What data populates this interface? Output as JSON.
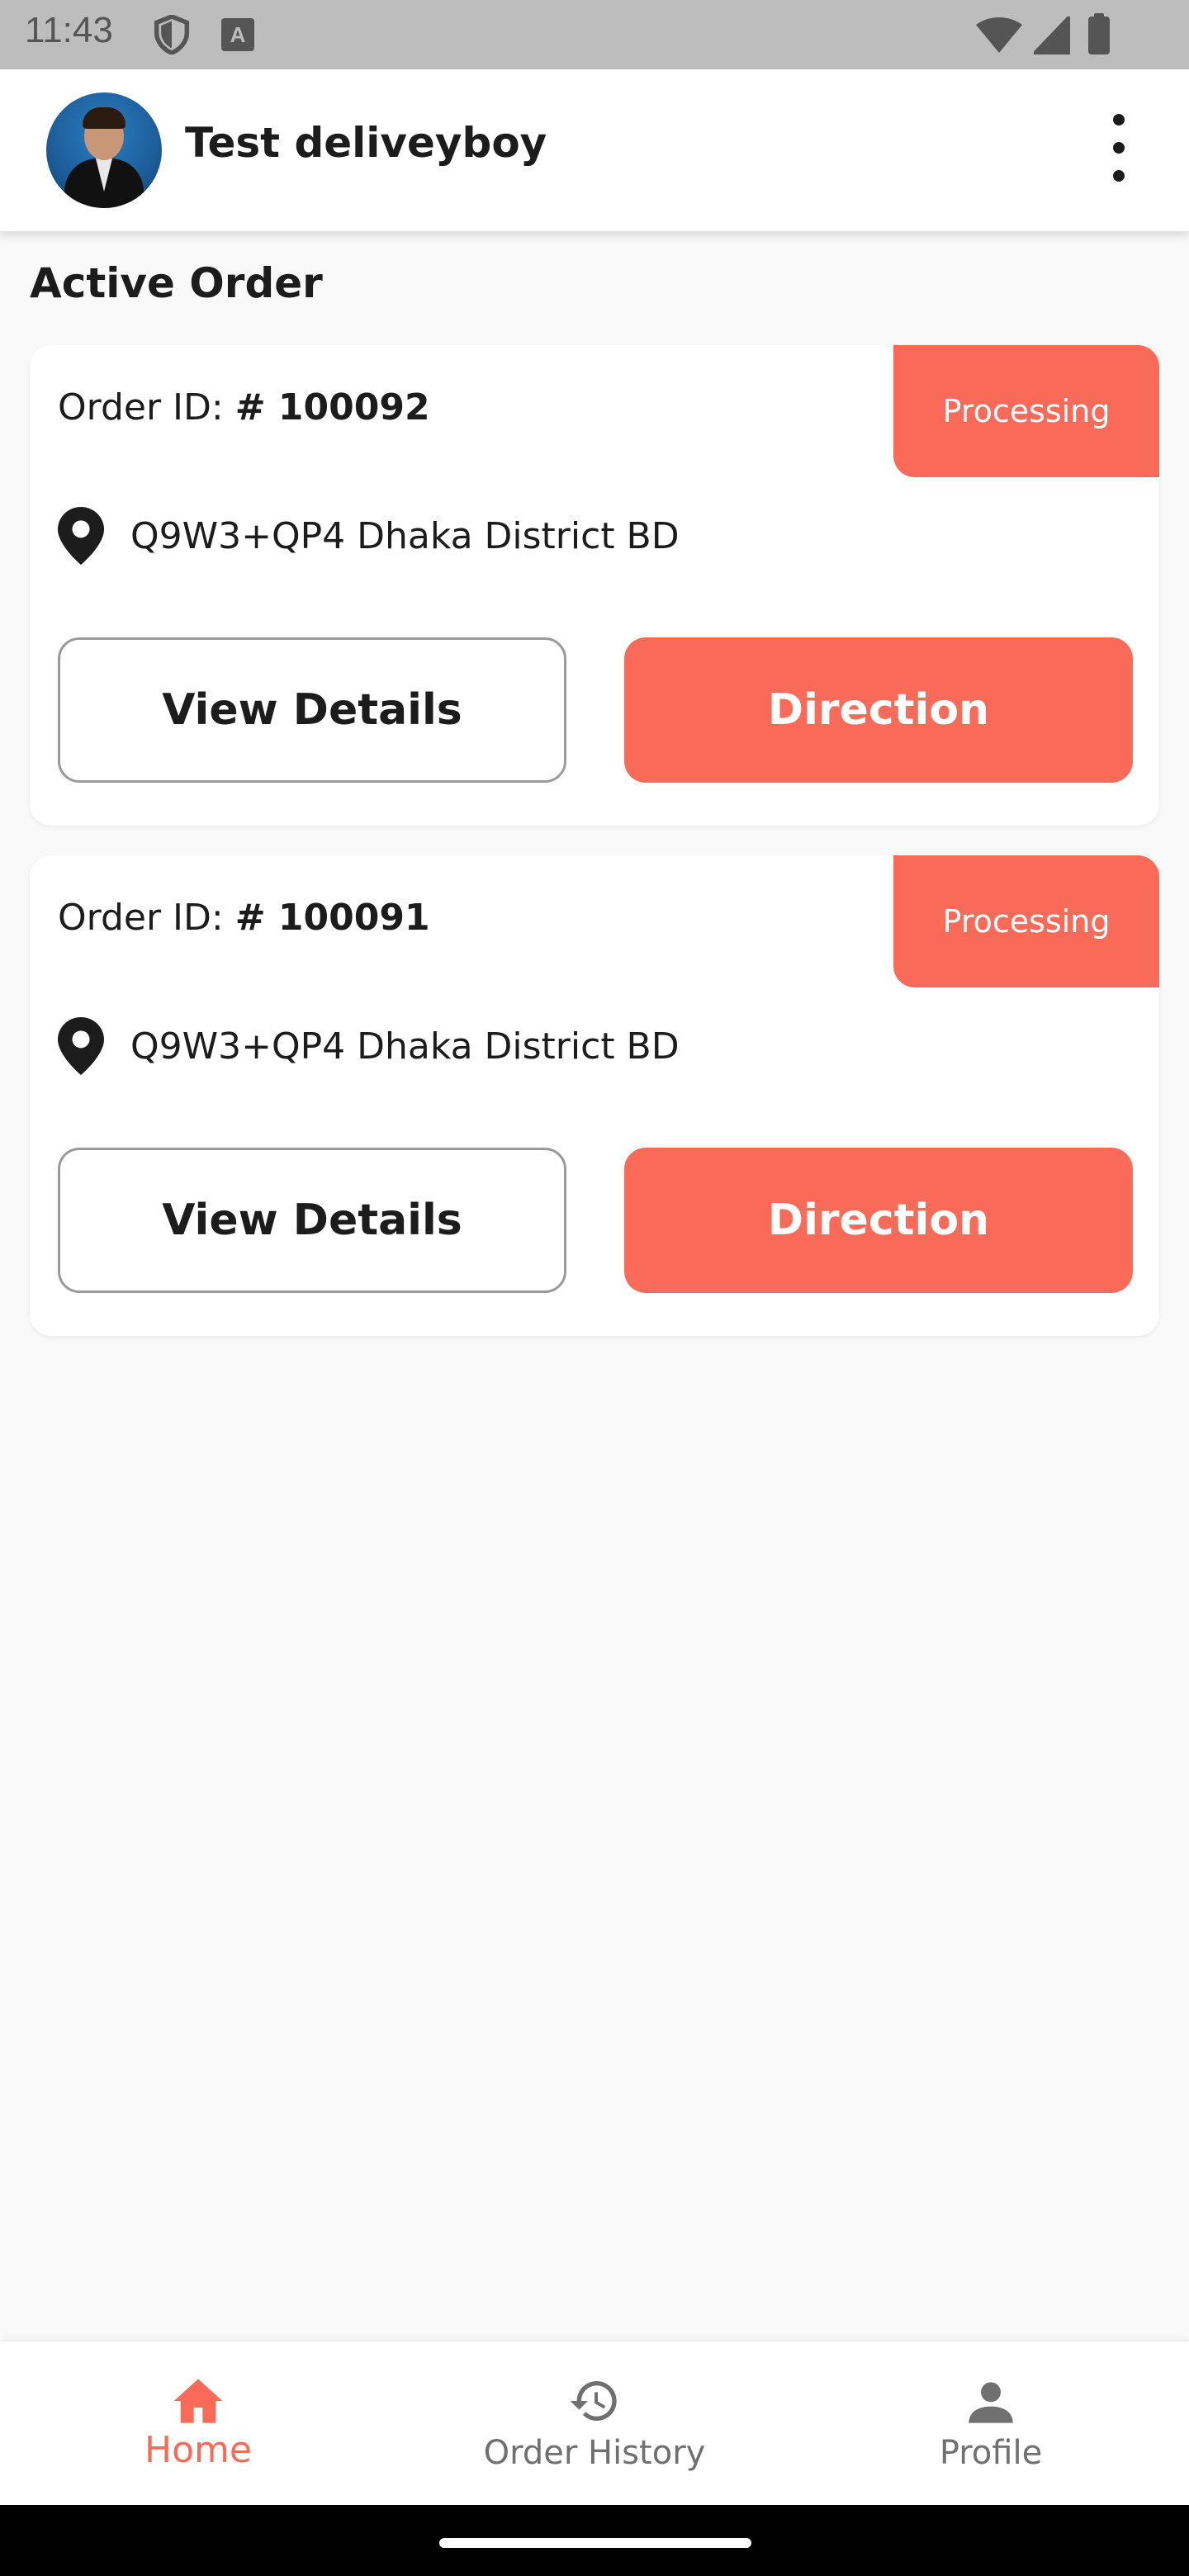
{
  "status_bar": {
    "time": "11:43",
    "icons": [
      "shield-icon",
      "text-a-icon",
      "wifi-icon",
      "signal-icon",
      "battery-icon"
    ],
    "a_glyph": "A"
  },
  "app_bar": {
    "user_name": "Test deliveyboy",
    "menu_icon": "more-vertical-icon"
  },
  "section": {
    "title": "Active Order"
  },
  "orders": [
    {
      "id_label": "Order ID:",
      "id_value": "# 100092",
      "status": "Processing",
      "address": "Q9W3+QP4 Dhaka District BD",
      "details_label": "View Details",
      "direction_label": "Direction"
    },
    {
      "id_label": "Order ID:",
      "id_value": "# 100091",
      "status": "Processing",
      "address": "Q9W3+QP4 Dhaka District BD",
      "details_label": "View Details",
      "direction_label": "Direction"
    }
  ],
  "bottom_nav": {
    "items": [
      {
        "label": "Home",
        "icon": "home-icon",
        "active": true
      },
      {
        "label": "Order History",
        "icon": "history-icon",
        "active": false
      },
      {
        "label": "Profile",
        "icon": "person-icon",
        "active": false
      }
    ]
  },
  "colors": {
    "accent": "#fa6a58",
    "text": "#1c1c1c",
    "background": "#f9f9f9",
    "inactive_nav": "#707070"
  }
}
